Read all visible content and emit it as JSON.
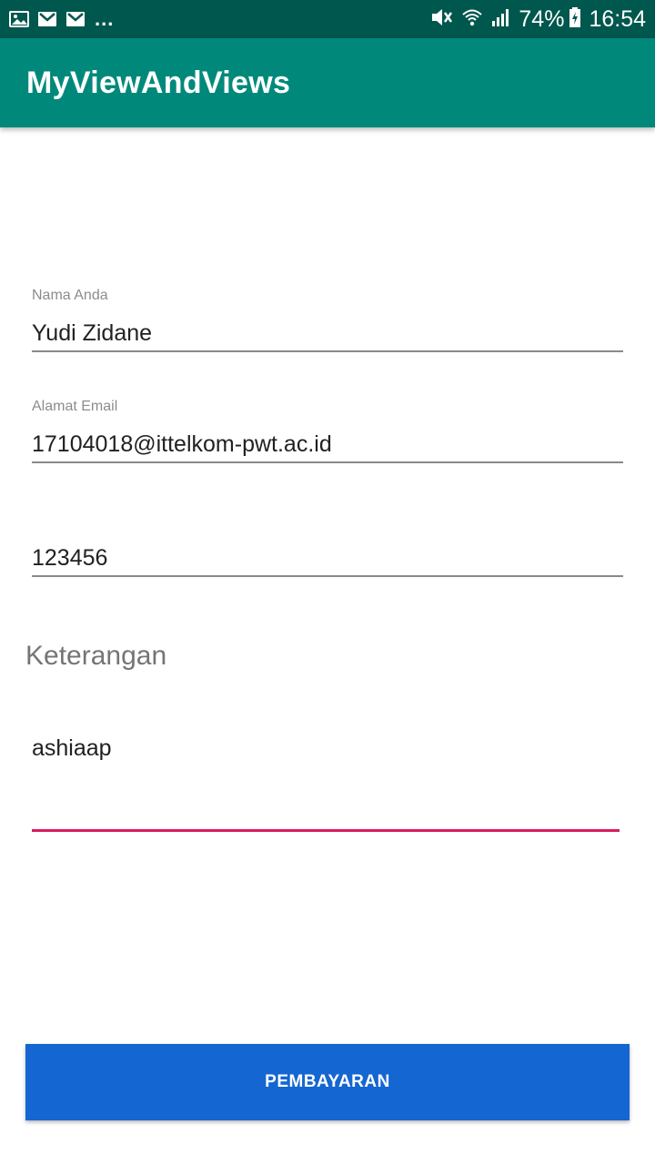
{
  "status_bar": {
    "left_icons": [
      "image-icon",
      "gmail-icon",
      "gmail-icon"
    ],
    "more": "...",
    "battery_percent": "74%",
    "time": "16:54"
  },
  "app_bar": {
    "title": "MyViewAndViews",
    "color": "#00897b"
  },
  "form": {
    "name": {
      "label": "Nama Anda",
      "value": "Yudi Zidane"
    },
    "email": {
      "label": "Alamat Email",
      "value": "17104018@ittelkom-pwt.ac.id"
    },
    "phone": {
      "value": "123456"
    },
    "notes_section": {
      "label": "Keterangan"
    },
    "notes": {
      "value": "ashiaap",
      "accent": "#d81b60"
    }
  },
  "pay_button": {
    "label": "PEMBAYARAN",
    "color": "#1466d2"
  }
}
